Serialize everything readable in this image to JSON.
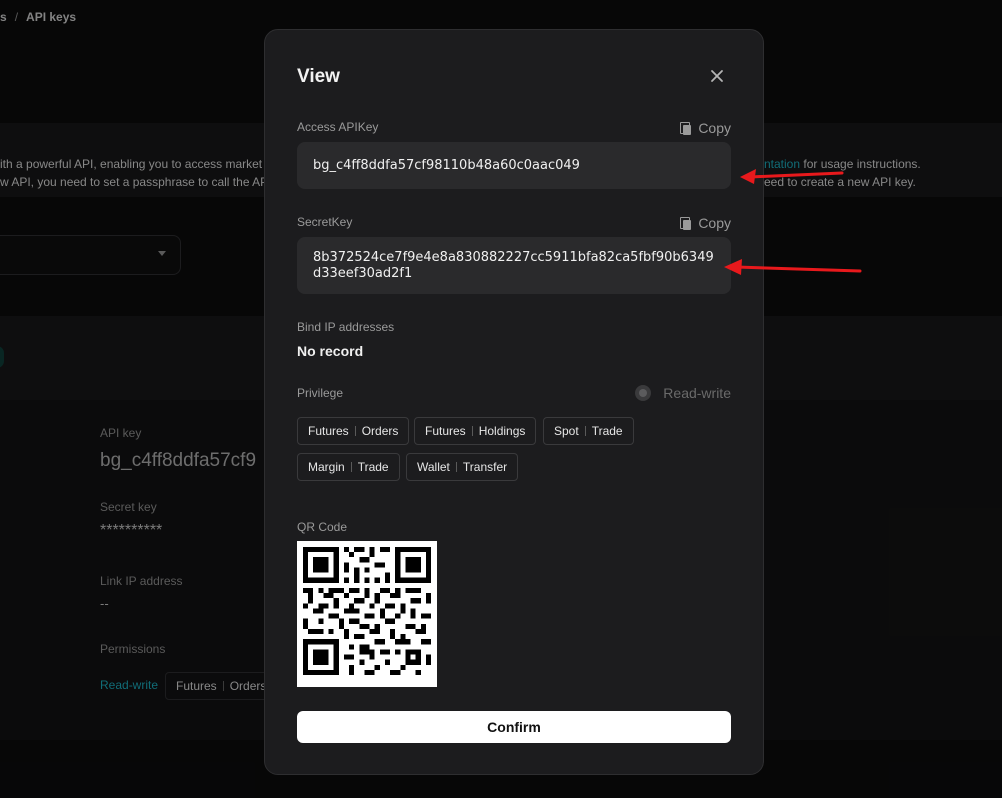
{
  "breadcrumb": {
    "prev": "s",
    "sep": "/",
    "current": "API keys"
  },
  "info": {
    "line1_left": "ith a powerful API, enabling you to access market",
    "line2_left": "w API, you need to set a passphrase to call the AP",
    "line1_link": "ntation",
    "line1_right": "for usage instructions.",
    "line2_right": "eed to create a new API key."
  },
  "detail": {
    "api_key_label": "API key",
    "api_key_value": "bg_c4ff8ddfa57cf9",
    "secret_key_label": "Secret key",
    "secret_key_value": "**********",
    "link_ip_label": "Link IP address",
    "link_ip_value": "--",
    "permissions_label": "Permissions",
    "permission_mode": "Read-write",
    "permission_chip": {
      "left": "Futures",
      "right": "Orders"
    }
  },
  "modal": {
    "title": "View",
    "access_key_label": "Access APIKey",
    "copy_label": "Copy",
    "access_key_value": "bg_c4ff8ddfa57cf98110b48a60c0aac049",
    "secret_key_label": "SecretKey",
    "secret_key_value": "8b372524ce7f9e4e8a830882227cc5911bfa82ca5fbf90b6349d33eef30ad2f1",
    "bind_ip_label": "Bind IP addresses",
    "bind_ip_value": "No record",
    "privilege_label": "Privilege",
    "privilege_mode": "Read-write",
    "privileges": [
      {
        "left": "Futures",
        "right": "Orders"
      },
      {
        "left": "Futures",
        "right": "Holdings"
      },
      {
        "left": "Spot",
        "right": "Trade"
      },
      {
        "left": "Margin",
        "right": "Trade"
      },
      {
        "left": "Wallet",
        "right": "Transfer"
      }
    ],
    "qr_label": "QR Code",
    "confirm_label": "Confirm"
  },
  "colors": {
    "accent_link": "#1aa6b7",
    "annotation_arrow": "#e8191c"
  },
  "icons": [
    "close-icon",
    "copy-icon",
    "radio-icon",
    "qr-code-image",
    "caret-down-icon",
    "red-arrow-annotation"
  ]
}
